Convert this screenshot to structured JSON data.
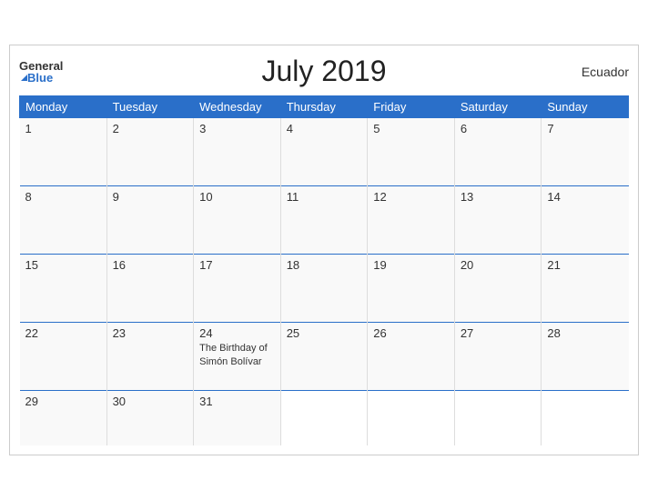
{
  "header": {
    "title": "July 2019",
    "country": "Ecuador",
    "logo_general": "General",
    "logo_blue": "Blue"
  },
  "weekdays": [
    "Monday",
    "Tuesday",
    "Wednesday",
    "Thursday",
    "Friday",
    "Saturday",
    "Sunday"
  ],
  "weeks": [
    [
      {
        "day": "1",
        "event": ""
      },
      {
        "day": "2",
        "event": ""
      },
      {
        "day": "3",
        "event": ""
      },
      {
        "day": "4",
        "event": ""
      },
      {
        "day": "5",
        "event": ""
      },
      {
        "day": "6",
        "event": ""
      },
      {
        "day": "7",
        "event": ""
      }
    ],
    [
      {
        "day": "8",
        "event": ""
      },
      {
        "day": "9",
        "event": ""
      },
      {
        "day": "10",
        "event": ""
      },
      {
        "day": "11",
        "event": ""
      },
      {
        "day": "12",
        "event": ""
      },
      {
        "day": "13",
        "event": ""
      },
      {
        "day": "14",
        "event": ""
      }
    ],
    [
      {
        "day": "15",
        "event": ""
      },
      {
        "day": "16",
        "event": ""
      },
      {
        "day": "17",
        "event": ""
      },
      {
        "day": "18",
        "event": ""
      },
      {
        "day": "19",
        "event": ""
      },
      {
        "day": "20",
        "event": ""
      },
      {
        "day": "21",
        "event": ""
      }
    ],
    [
      {
        "day": "22",
        "event": ""
      },
      {
        "day": "23",
        "event": ""
      },
      {
        "day": "24",
        "event": "The Birthday of Simón Bolívar"
      },
      {
        "day": "25",
        "event": ""
      },
      {
        "day": "26",
        "event": ""
      },
      {
        "day": "27",
        "event": ""
      },
      {
        "day": "28",
        "event": ""
      }
    ],
    [
      {
        "day": "29",
        "event": ""
      },
      {
        "day": "30",
        "event": ""
      },
      {
        "day": "31",
        "event": ""
      },
      {
        "day": "",
        "event": ""
      },
      {
        "day": "",
        "event": ""
      },
      {
        "day": "",
        "event": ""
      },
      {
        "day": "",
        "event": ""
      }
    ]
  ]
}
